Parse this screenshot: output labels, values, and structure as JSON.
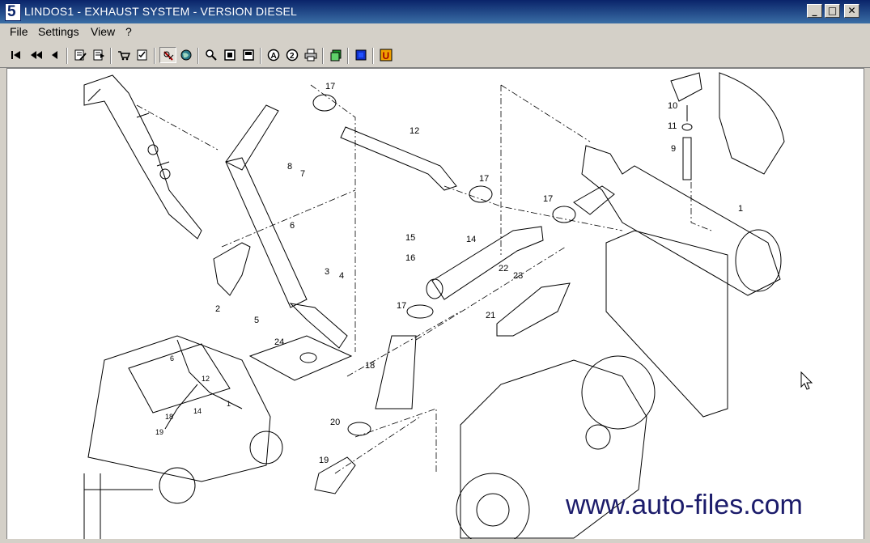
{
  "window": {
    "app_icon_glyph": "5",
    "title": "LINDOS1 - EXHAUST SYSTEM - VERSION DIESEL",
    "minimize_glyph": "_",
    "maximize_glyph": "□",
    "close_glyph": "✕"
  },
  "menu": {
    "file": "File",
    "settings": "Settings",
    "view": "View",
    "help": "?"
  },
  "toolbar": {
    "icons": [
      "first-page-icon",
      "previous-fast-icon",
      "previous-icon",
      "edit-document-icon",
      "export-document-icon",
      "cart-icon",
      "checklist-icon",
      "pin-tool-icon",
      "globe-icon",
      "zoom-icon",
      "fit-page-icon",
      "fit-width-icon",
      "search-a-icon",
      "search-2-icon",
      "print-icon",
      "layer-icon",
      "color-icon",
      "unit-icon"
    ]
  },
  "diagram": {
    "part_labels": [
      "1",
      "2",
      "3",
      "4",
      "5",
      "6",
      "7",
      "8",
      "9",
      "10",
      "11",
      "12",
      "14",
      "15",
      "16",
      "17",
      "18",
      "19",
      "20",
      "21",
      "22",
      "23",
      "24"
    ],
    "inset_labels": [
      "6",
      "12",
      "1",
      "14",
      "18",
      "19"
    ],
    "watermark": "www.auto-files.com"
  },
  "colors": {
    "title_bar_start": "#0a246a",
    "title_bar_end": "#3a6ea5",
    "chrome": "#d4d0c8",
    "watermark": "#1c1c6b"
  }
}
